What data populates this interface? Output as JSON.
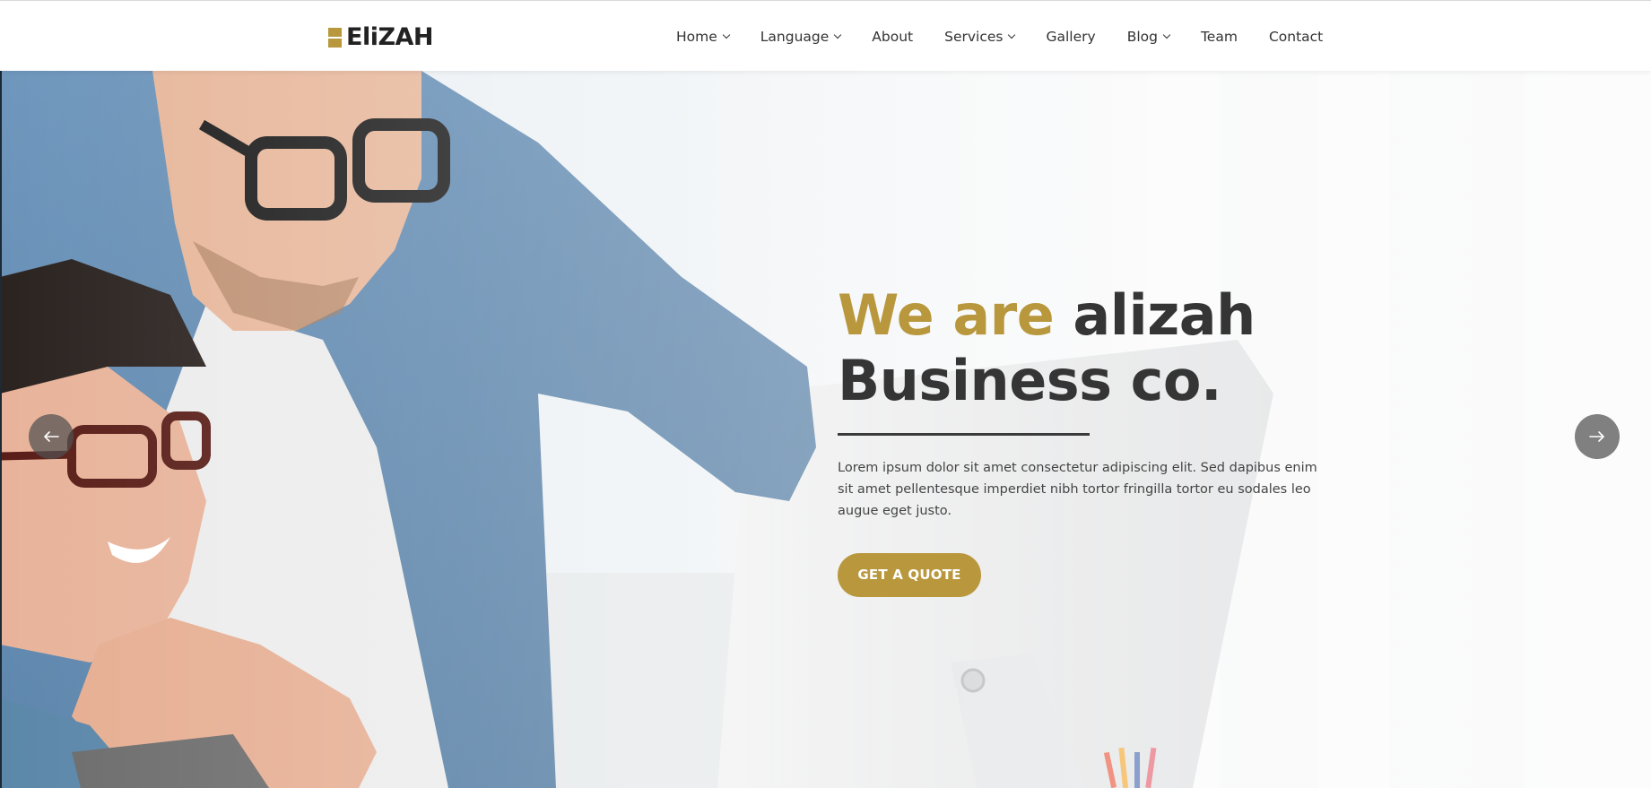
{
  "header": {
    "logo_text": "EliZAH",
    "nav": [
      {
        "label": "Home",
        "dropdown": true
      },
      {
        "label": "Language",
        "dropdown": true
      },
      {
        "label": "About",
        "dropdown": false
      },
      {
        "label": "Services",
        "dropdown": true
      },
      {
        "label": "Gallery",
        "dropdown": false
      },
      {
        "label": "Blog",
        "dropdown": true
      },
      {
        "label": "Team",
        "dropdown": false
      },
      {
        "label": "Contact",
        "dropdown": false
      }
    ]
  },
  "hero": {
    "title_accent": "We are",
    "title_rest": "alizah",
    "title_line2": "Business co.",
    "description": "Lorem ipsum dolor sit amet consectetur adipiscing elit. Sed dapibus enim sit amet pellentesque imperdiet nibh tortor fringilla tortor eu sodales leo augue eget justo.",
    "cta_label": "GET A QUOTE",
    "prev_icon": "arrow-left-icon",
    "next_icon": "arrow-right-icon"
  },
  "colors": {
    "accent": "#b8973d",
    "heading": "#353535",
    "arrow_bg": "#505050"
  }
}
